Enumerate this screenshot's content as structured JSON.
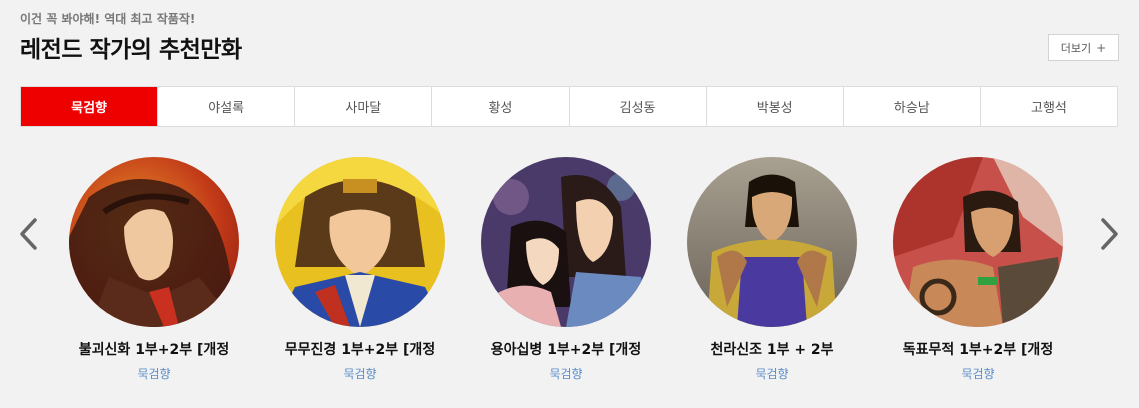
{
  "header": {
    "subtitle": "이건 꼭 봐야해! 역대 최고 작품작!",
    "title": "레전드 작가의 추천만화",
    "more_label": "더보기",
    "more_icon": "plus-icon"
  },
  "tabs": [
    {
      "label": "묵검향",
      "active": true
    },
    {
      "label": "야설록",
      "active": false
    },
    {
      "label": "사마달",
      "active": false
    },
    {
      "label": "황성",
      "active": false
    },
    {
      "label": "김성동",
      "active": false
    },
    {
      "label": "박봉성",
      "active": false
    },
    {
      "label": "하승남",
      "active": false
    },
    {
      "label": "고행석",
      "active": false
    }
  ],
  "carousel": {
    "prev_icon": "chevron-left-icon",
    "next_icon": "chevron-right-icon",
    "items": [
      {
        "title": "불괴신화 1부+2부 [개정",
        "author": "묵검향"
      },
      {
        "title": "무무진경 1부+2부 [개정",
        "author": "묵검향"
      },
      {
        "title": "용아십병 1부+2부 [개정",
        "author": "묵검향"
      },
      {
        "title": "천라신조 1부 + 2부",
        "author": "묵검향"
      },
      {
        "title": "독표무적 1부+2부 [개정",
        "author": "묵검향"
      }
    ]
  },
  "colors": {
    "accent": "#ee0000",
    "author": "#5a8ec8"
  }
}
